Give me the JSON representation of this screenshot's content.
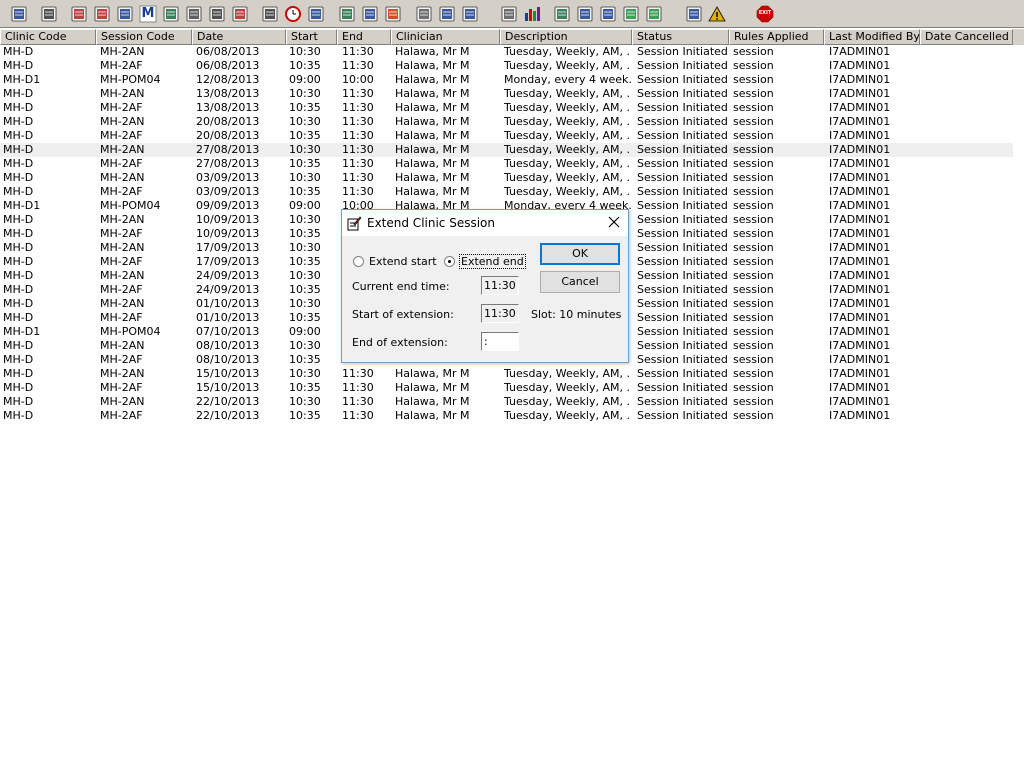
{
  "toolbar": {
    "icons": [
      "user-lookup-icon",
      "printer-icon",
      "book-icon",
      "edit-record-icon",
      "calculator-icon",
      "letter-m-icon",
      "person-icon",
      "notes-icon",
      "transport-icon",
      "flag-icon",
      "search-doc-icon",
      "clock-icon",
      "monitor-icon",
      "chart-doc-icon",
      "message-icon",
      "compass-icon",
      "notepad-icon",
      "printer-small-icon",
      "printer-person-icon",
      "page-icon",
      "bar-chart-icon",
      "globe-icon",
      "check-doc-icon",
      "check-list-icon",
      "green-check-icon",
      "green-arrow-icon",
      "swap-icon",
      "warning-icon",
      "exit-icon"
    ],
    "exit_label": "EXIT",
    "m_label": "M"
  },
  "columns": [
    "Clinic Code",
    "Session Code",
    "Date",
    "Start",
    "End",
    "Clinician",
    "Description",
    "Status",
    "Rules Applied",
    "Last Modified By",
    "Date Cancelled"
  ],
  "rows": [
    [
      "MH-D",
      "MH-2AN",
      "06/08/2013",
      "10:30",
      "11:30",
      "Halawa, Mr M",
      "Tuesday, Weekly, AM, ...",
      "Session Initiated",
      "session",
      "I7ADMIN01",
      ""
    ],
    [
      "MH-D",
      "MH-2AF",
      "06/08/2013",
      "10:35",
      "11:30",
      "Halawa, Mr M",
      "Tuesday, Weekly, AM, ...",
      "Session Initiated",
      "session",
      "I7ADMIN01",
      ""
    ],
    [
      "MH-D1",
      "MH-POM04",
      "12/08/2013",
      "09:00",
      "10:00",
      "Halawa, Mr M",
      "Monday, every 4 week...",
      "Session Initiated",
      "session",
      "I7ADMIN01",
      ""
    ],
    [
      "MH-D",
      "MH-2AN",
      "13/08/2013",
      "10:30",
      "11:30",
      "Halawa, Mr M",
      "Tuesday, Weekly, AM, ...",
      "Session Initiated",
      "session",
      "I7ADMIN01",
      ""
    ],
    [
      "MH-D",
      "MH-2AF",
      "13/08/2013",
      "10:35",
      "11:30",
      "Halawa, Mr M",
      "Tuesday, Weekly, AM, ...",
      "Session Initiated",
      "session",
      "I7ADMIN01",
      ""
    ],
    [
      "MH-D",
      "MH-2AN",
      "20/08/2013",
      "10:30",
      "11:30",
      "Halawa, Mr M",
      "Tuesday, Weekly, AM, ...",
      "Session Initiated",
      "session",
      "I7ADMIN01",
      ""
    ],
    [
      "MH-D",
      "MH-2AF",
      "20/08/2013",
      "10:35",
      "11:30",
      "Halawa, Mr M",
      "Tuesday, Weekly, AM, ...",
      "Session Initiated",
      "session",
      "I7ADMIN01",
      ""
    ],
    [
      "MH-D",
      "MH-2AN",
      "27/08/2013",
      "10:30",
      "11:30",
      "Halawa, Mr M",
      "Tuesday, Weekly, AM, ...",
      "Session Initiated",
      "session",
      "I7ADMIN01",
      ""
    ],
    [
      "MH-D",
      "MH-2AF",
      "27/08/2013",
      "10:35",
      "11:30",
      "Halawa, Mr M",
      "Tuesday, Weekly, AM, ...",
      "Session Initiated",
      "session",
      "I7ADMIN01",
      ""
    ],
    [
      "MH-D",
      "MH-2AN",
      "03/09/2013",
      "10:30",
      "11:30",
      "Halawa, Mr M",
      "Tuesday, Weekly, AM, ...",
      "Session Initiated",
      "session",
      "I7ADMIN01",
      ""
    ],
    [
      "MH-D",
      "MH-2AF",
      "03/09/2013",
      "10:35",
      "11:30",
      "Halawa, Mr M",
      "Tuesday, Weekly, AM, ...",
      "Session Initiated",
      "session",
      "I7ADMIN01",
      ""
    ],
    [
      "MH-D1",
      "MH-POM04",
      "09/09/2013",
      "09:00",
      "10:00",
      "Halawa, Mr M",
      "Monday, every 4 week...",
      "Session Initiated",
      "session",
      "I7ADMIN01",
      ""
    ],
    [
      "MH-D",
      "MH-2AN",
      "10/09/2013",
      "10:30",
      "",
      "",
      "",
      "Session Initiated",
      "session",
      "I7ADMIN01",
      ""
    ],
    [
      "MH-D",
      "MH-2AF",
      "10/09/2013",
      "10:35",
      "",
      "",
      "",
      "Session Initiated",
      "session",
      "I7ADMIN01",
      ""
    ],
    [
      "MH-D",
      "MH-2AN",
      "17/09/2013",
      "10:30",
      "",
      "",
      "",
      "Session Initiated",
      "session",
      "I7ADMIN01",
      ""
    ],
    [
      "MH-D",
      "MH-2AF",
      "17/09/2013",
      "10:35",
      "",
      "",
      "",
      "Session Initiated",
      "session",
      "I7ADMIN01",
      ""
    ],
    [
      "MH-D",
      "MH-2AN",
      "24/09/2013",
      "10:30",
      "",
      "",
      "",
      "Session Initiated",
      "session",
      "I7ADMIN01",
      ""
    ],
    [
      "MH-D",
      "MH-2AF",
      "24/09/2013",
      "10:35",
      "",
      "",
      "",
      "Session Initiated",
      "session",
      "I7ADMIN01",
      ""
    ],
    [
      "MH-D",
      "MH-2AN",
      "01/10/2013",
      "10:30",
      "",
      "",
      "",
      "Session Initiated",
      "session",
      "I7ADMIN01",
      ""
    ],
    [
      "MH-D",
      "MH-2AF",
      "01/10/2013",
      "10:35",
      "",
      "",
      "",
      "Session Initiated",
      "session",
      "I7ADMIN01",
      ""
    ],
    [
      "MH-D1",
      "MH-POM04",
      "07/10/2013",
      "09:00",
      "",
      "",
      "",
      "Session Initiated",
      "session",
      "I7ADMIN01",
      ""
    ],
    [
      "MH-D",
      "MH-2AN",
      "08/10/2013",
      "10:30",
      "",
      "",
      "",
      "Session Initiated",
      "session",
      "I7ADMIN01",
      ""
    ],
    [
      "MH-D",
      "MH-2AF",
      "08/10/2013",
      "10:35",
      "",
      "",
      "",
      "Session Initiated",
      "session",
      "I7ADMIN01",
      ""
    ],
    [
      "MH-D",
      "MH-2AN",
      "15/10/2013",
      "10:30",
      "11:30",
      "Halawa, Mr M",
      "Tuesday, Weekly, AM, ...",
      "Session Initiated",
      "session",
      "I7ADMIN01",
      ""
    ],
    [
      "MH-D",
      "MH-2AF",
      "15/10/2013",
      "10:35",
      "11:30",
      "Halawa, Mr M",
      "Tuesday, Weekly, AM, ...",
      "Session Initiated",
      "session",
      "I7ADMIN01",
      ""
    ],
    [
      "MH-D",
      "MH-2AN",
      "22/10/2013",
      "10:30",
      "11:30",
      "Halawa, Mr M",
      "Tuesday, Weekly, AM, ...",
      "Session Initiated",
      "session",
      "I7ADMIN01",
      ""
    ],
    [
      "MH-D",
      "MH-2AF",
      "22/10/2013",
      "10:35",
      "11:30",
      "Halawa, Mr M",
      "Tuesday, Weekly, AM, ...",
      "Session Initiated",
      "session",
      "I7ADMIN01",
      ""
    ]
  ],
  "highlighted_row": 7,
  "dialog": {
    "title": "Extend Clinic Session",
    "radio_start": "Extend start",
    "radio_end": "Extend end",
    "selected": "end",
    "current_end_label": "Current end time:",
    "current_end_value": "11:30",
    "start_ext_label": "Start of extension:",
    "start_ext_value": "11:30",
    "end_ext_label": "End of extension:",
    "end_ext_value": " :",
    "slot_label": "Slot: 10 minutes",
    "ok_label": "OK",
    "cancel_label": "Cancel"
  },
  "colors": {
    "toolbar_bg": "#d4d0c8",
    "highlight_row": "#efefef",
    "dialog_border": "#6f9ec7",
    "default_button": "#0078d7"
  }
}
